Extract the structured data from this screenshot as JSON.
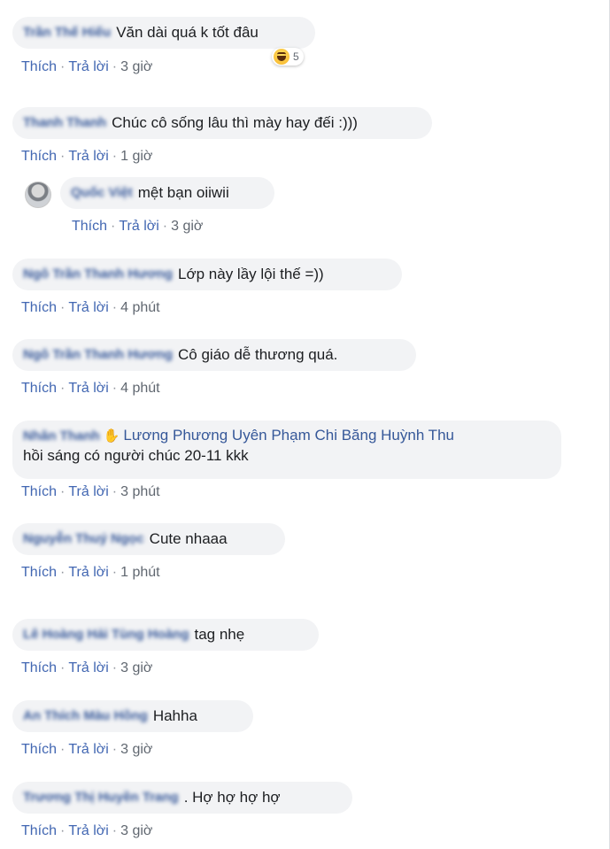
{
  "actions": {
    "like": "Thích",
    "reply": "Trả lời",
    "sep": "·"
  },
  "comments": [
    {
      "author": "Trần Thế Hiếu",
      "text": "Văn dài quá k tốt đâu",
      "time": "3 giờ",
      "reaction_count": "5",
      "reaction_icon": "haha-emoji-icon"
    },
    {
      "author": "Thanh Thanh",
      "text": "Chúc cô sống lâu thì mày hay đếi :)))",
      "time": "1 giờ"
    },
    {
      "author": "Quốc Việt",
      "text": "mệt bạn oiiwii",
      "time": "3 giờ"
    },
    {
      "author": "Ngô Trần Thanh Hương",
      "text": "Lớp này lầy lội thế =))",
      "time": "4 phút"
    },
    {
      "author": "Ngô Trần Thanh Hương",
      "text": "Cô giáo dễ thương quá.",
      "time": "4 phút"
    },
    {
      "author": "Nhân Thanh",
      "tags": "Lương Phương Uyên Phạm Chi Băng Huỳnh Thu",
      "text": "hồi sáng có người chúc 20-11 kkk",
      "time": "3 phút",
      "icon": "waving-hand-icon"
    },
    {
      "author": "Nguyễn Thuý Ngọc",
      "text": "Cute nhaaa",
      "time": "1 phút"
    },
    {
      "author": "Lê Hoàng Hải Tùng Hoàng",
      "text": "tag nhẹ",
      "time": "3 giờ"
    },
    {
      "author": "An Thích Màu Hồng",
      "text": "Hahha",
      "time": "3 giờ"
    },
    {
      "author": "Trương Thị Huyền Trang",
      "text": ". Hợ hợ hợ hợ",
      "time": "3 giờ"
    }
  ]
}
